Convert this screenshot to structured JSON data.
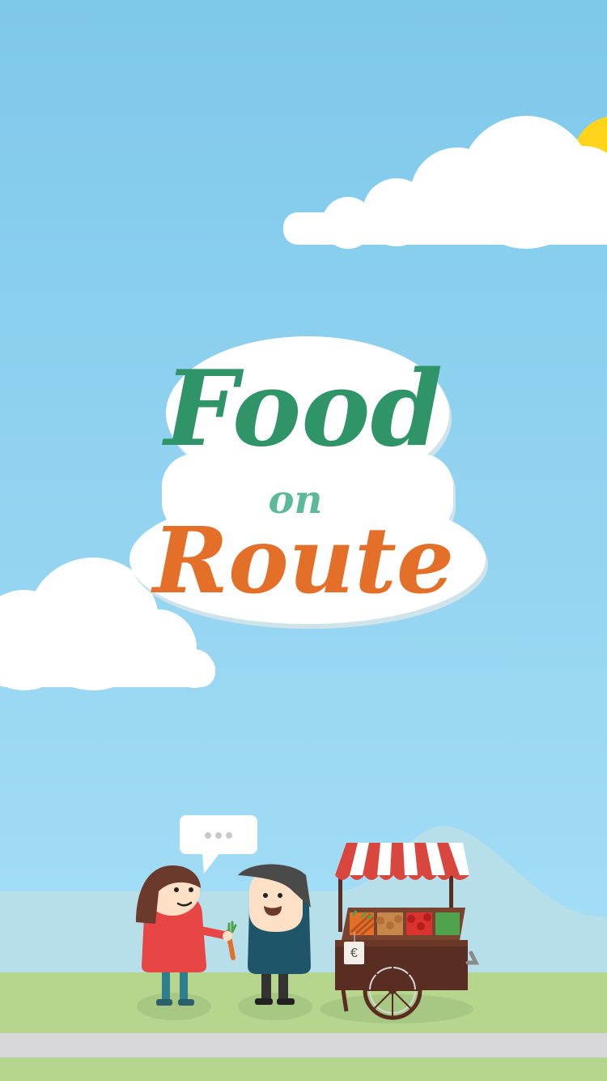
{
  "screen": "splash",
  "logo": {
    "line1": "Food",
    "line2": "on",
    "line3": "Route"
  },
  "speech_bubble": {
    "text": "•••"
  },
  "price_tag": {
    "text": "€"
  },
  "colors": {
    "sky_top": "#7ec8ea",
    "sky_bottom": "#a6def7",
    "cloud": "#ffffff",
    "sun": "#ffd41a",
    "hill": "#b6dfe9",
    "grass": "#b6d68e",
    "path": "#d7d6d8",
    "logo_green": "#2f9568",
    "logo_mint": "#5cb99a",
    "logo_orange": "#e46f29",
    "awning_red": "#d9463e",
    "cart_brown": "#5a2d22"
  }
}
